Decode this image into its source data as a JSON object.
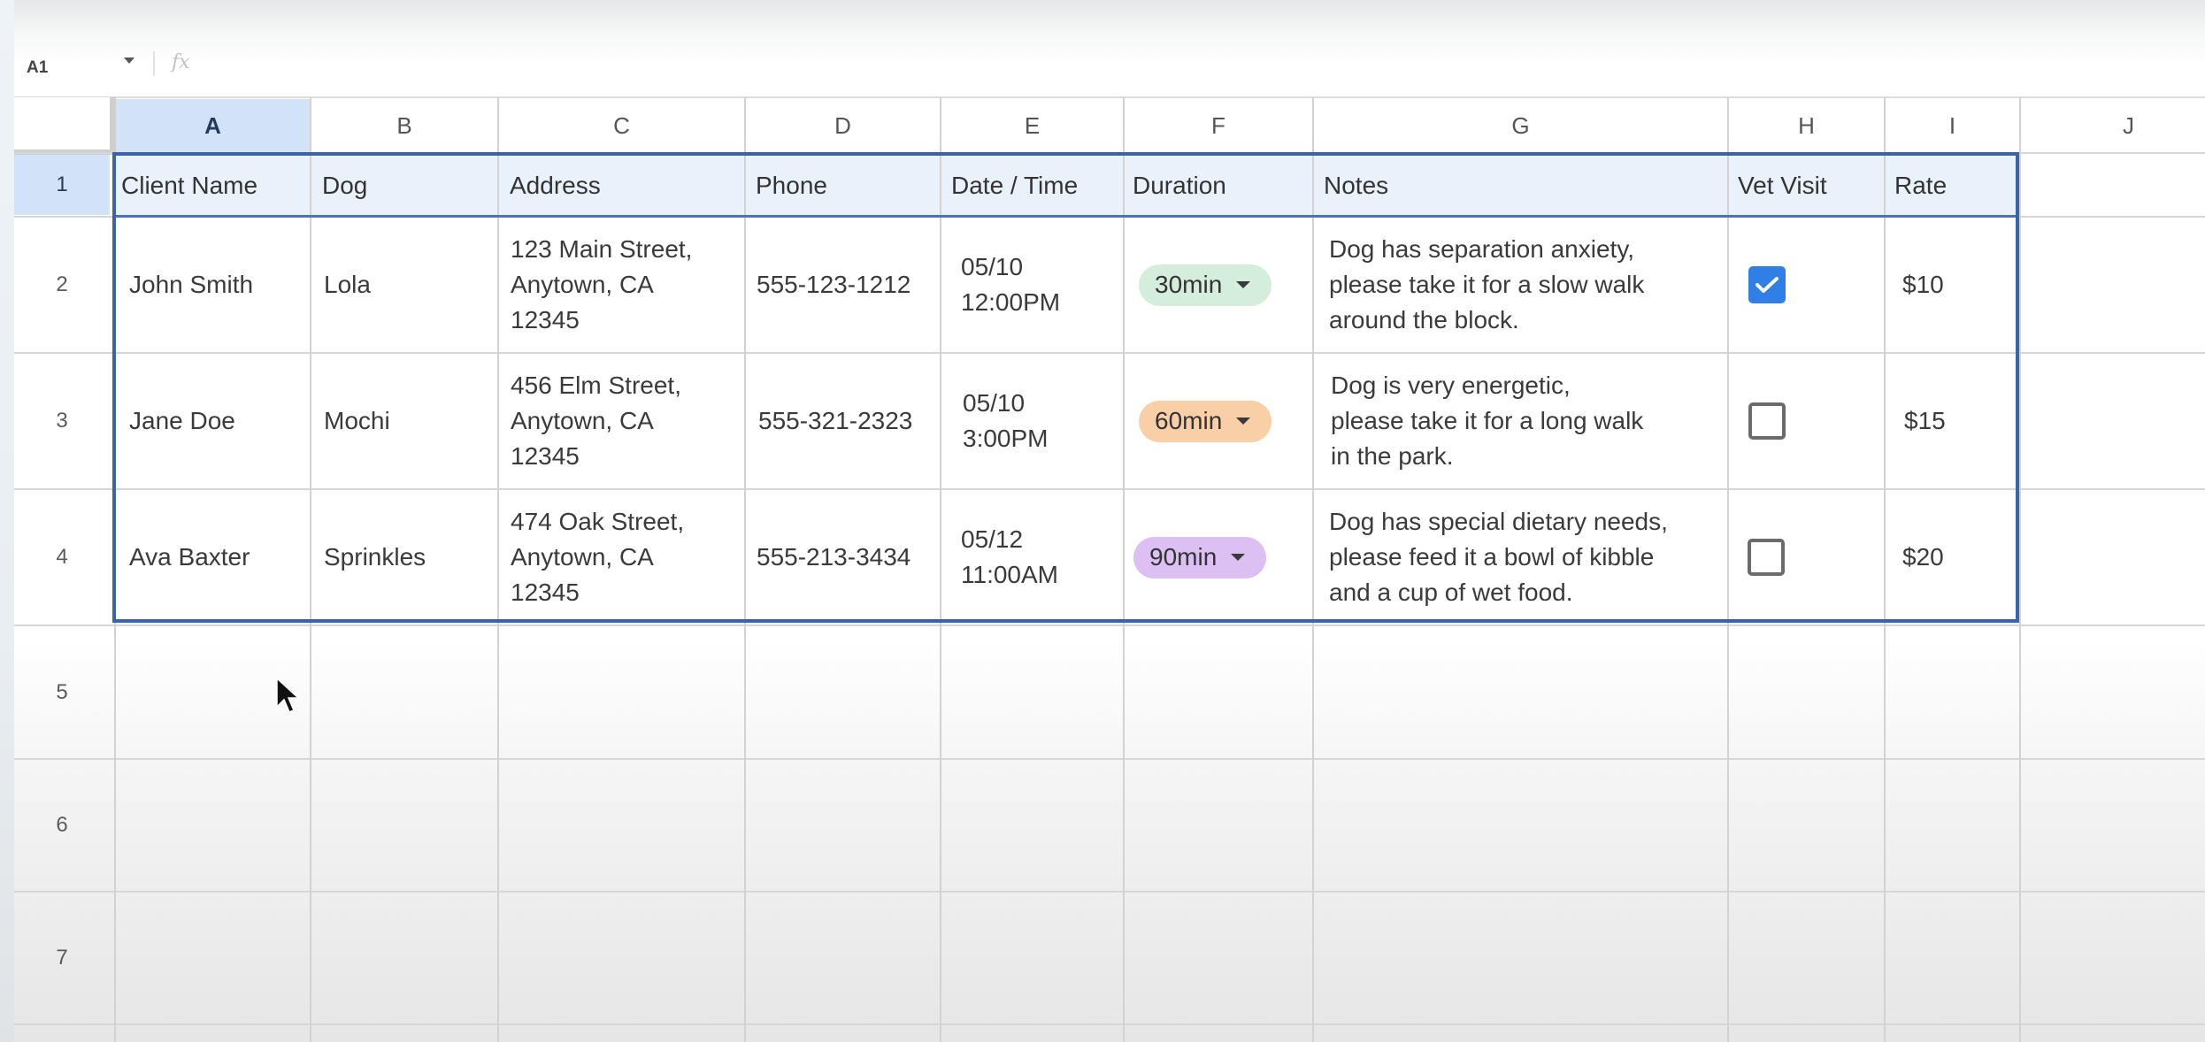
{
  "formula_bar": {
    "name_box": "A1",
    "fx_label": "fx",
    "formula": ""
  },
  "columns": [
    "A",
    "B",
    "C",
    "D",
    "E",
    "F",
    "G",
    "H",
    "I",
    "J"
  ],
  "selected_column": "A",
  "rows": [
    "1",
    "2",
    "3",
    "4",
    "5",
    "6",
    "7"
  ],
  "selected_row": "1",
  "table": {
    "headers": {
      "client_name": "Client Name",
      "dog": "Dog",
      "address": "Address",
      "phone": "Phone",
      "date_time": "Date / Time",
      "duration": "Duration",
      "notes": "Notes",
      "vet_visit": "Vet Visit",
      "rate": "Rate"
    },
    "records": [
      {
        "client_name": "John Smith",
        "dog": "Lola",
        "address": "123 Main Street,\nAnytown, CA\n12345",
        "phone": "555-123-1212",
        "date_time": "05/10\n12:00PM",
        "duration": "30min",
        "duration_color": "#d5eedc",
        "notes": "Dog has separation anxiety,\nplease take it for a slow walk\naround the block.",
        "vet_visit": true,
        "rate": "$10"
      },
      {
        "client_name": "Jane Doe",
        "dog": "Mochi",
        "address": "456 Elm Street,\nAnytown, CA\n12345",
        "phone": "555-321-2323",
        "date_time": "05/10\n3:00PM",
        "duration": "60min",
        "duration_color": "#f9cfa8",
        "notes": "Dog is very energetic,\nplease take it for a long walk\nin the park.",
        "vet_visit": false,
        "rate": "$15"
      },
      {
        "client_name": "Ava Baxter",
        "dog": "Sprinkles",
        "address": "474 Oak Street,\nAnytown, CA\n12345",
        "phone": "555-213-3434",
        "date_time": "05/12\n11:00AM",
        "duration": "90min",
        "duration_color": "#dcc0f4",
        "notes": "Dog has special dietary needs,\nplease feed it a bowl of kibble\nand a cup of wet food.",
        "vet_visit": false,
        "rate": "$20"
      }
    ]
  },
  "colors": {
    "selection_border": "#3a64a8",
    "header_band": "#e9f1fb",
    "selected_header": "#d3e3f7",
    "checkbox_checked": "#2f7fe6"
  }
}
